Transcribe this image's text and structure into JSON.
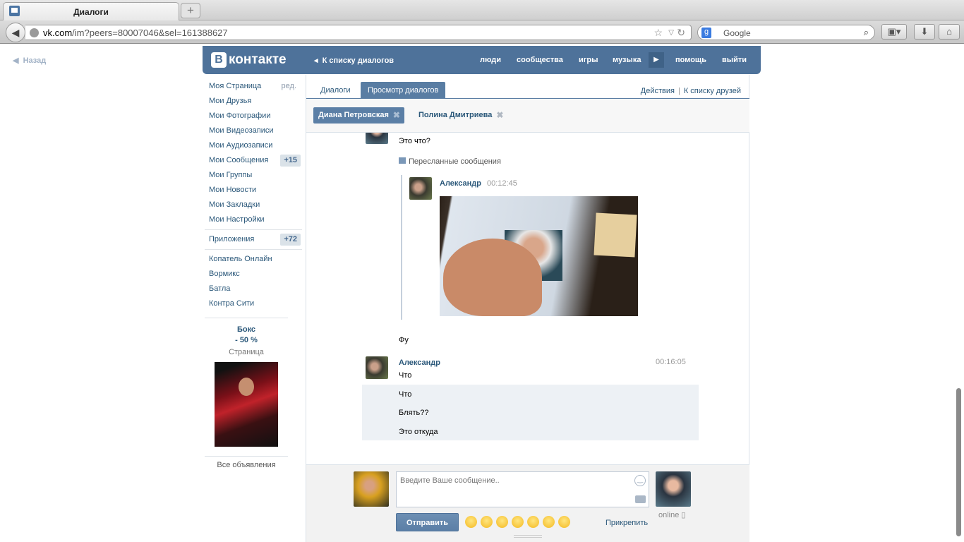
{
  "browser": {
    "tab_title": "Диалоги",
    "url_host": "vk.com",
    "url_path": "/im?peers=80007046&sel=161388627",
    "search_placeholder": "Google"
  },
  "page_back": "Назад",
  "header": {
    "logo": "ВКонтакте",
    "logo_letter": "В",
    "logo_text": "контакте",
    "back_to_list": "К списку диалогов",
    "nav": [
      "люди",
      "сообщества",
      "игры",
      "музыка",
      "помощь",
      "выйти"
    ]
  },
  "menu": {
    "items": [
      {
        "label": "Моя Страница",
        "extra": "ред."
      },
      {
        "label": "Мои Друзья"
      },
      {
        "label": "Мои Фотографии"
      },
      {
        "label": "Мои Видеозаписи"
      },
      {
        "label": "Мои Аудиозаписи"
      },
      {
        "label": "Мои Сообщения",
        "badge": "+15"
      },
      {
        "label": "Мои Группы"
      },
      {
        "label": "Мои Новости"
      },
      {
        "label": "Мои Закладки"
      },
      {
        "label": "Мои Настройки"
      }
    ],
    "apps": {
      "label": "Приложения",
      "badge": "+72"
    },
    "app_items": [
      "Копатель Онлайн",
      "Вормикс",
      "Батла",
      "Контра Сити"
    ]
  },
  "ad": {
    "title": "Бокс",
    "subtitle": "- 50 %",
    "type": "Страница",
    "all": "Все объявления"
  },
  "tabs": {
    "dialogs": "Диалоги",
    "view": "Просмотр диалогов",
    "actions": "Действия",
    "sep": "|",
    "friends": "К списку друзей"
  },
  "chips": [
    "Диана Петровская",
    "Полина Дмитриева"
  ],
  "messages": {
    "m1": "Это что?",
    "forwarded_label": "Пересланные сообщения",
    "fwd_author": "Александр",
    "fwd_time": "00:12:45",
    "m2": "Фу",
    "author": "Александр",
    "time": "00:16:05",
    "m3": "Что",
    "unread": [
      "Что",
      "Блять??",
      "Это откуда"
    ]
  },
  "composer": {
    "placeholder": "Введите Ваше сообщение..",
    "send": "Отправить",
    "attach": "Прикрепить",
    "online": "online"
  }
}
